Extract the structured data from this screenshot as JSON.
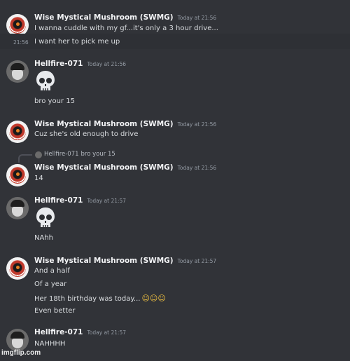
{
  "messages": [
    {
      "author": "Wise Mystical Mushroom (SWMG)",
      "timestamp": "Today at 21:56",
      "lines": [
        "I wanna cuddle with my gf...it's only a 3 hour drive..."
      ]
    },
    {
      "side_timestamp": "21:56",
      "lines": [
        "I want her to pick me up"
      ]
    },
    {
      "author": "Hellfire-071",
      "timestamp": "Today at 21:56",
      "emoji": "skull",
      "lines": [
        "bro your 15"
      ]
    },
    {
      "author": "Wise Mystical Mushroom (SWMG)",
      "timestamp": "Today at 21:56",
      "lines": [
        "Cuz she's old enough to drive"
      ]
    },
    {
      "reply": {
        "author": "Hellfire-071",
        "text": "bro your 15"
      },
      "author": "Wise Mystical Mushroom (SWMG)",
      "timestamp": "Today at 21:56",
      "lines": [
        "14"
      ]
    },
    {
      "author": "Hellfire-071",
      "timestamp": "Today at 21:57",
      "emoji": "skull",
      "lines": [
        "NAhh"
      ]
    },
    {
      "author": "Wise Mystical Mushroom (SWMG)",
      "timestamp": "Today at 21:57",
      "lines": [
        "And a half",
        "Of a year",
        "Her 18th birthday was today...",
        "Even better"
      ],
      "inline_emojis": "☺☺☺"
    },
    {
      "author": "Hellfire-071",
      "timestamp": "Today at 21:57",
      "lines": [
        "NAHHHH"
      ]
    }
  ],
  "watermark": "imgflip.com",
  "colors": {
    "background": "#313338",
    "text": "#dbdee1",
    "muted": "#949ba4",
    "author": "#f2f3f5"
  },
  "icons": {
    "skull": "skull-emoji-icon",
    "reply": "reply-arrow-icon"
  }
}
